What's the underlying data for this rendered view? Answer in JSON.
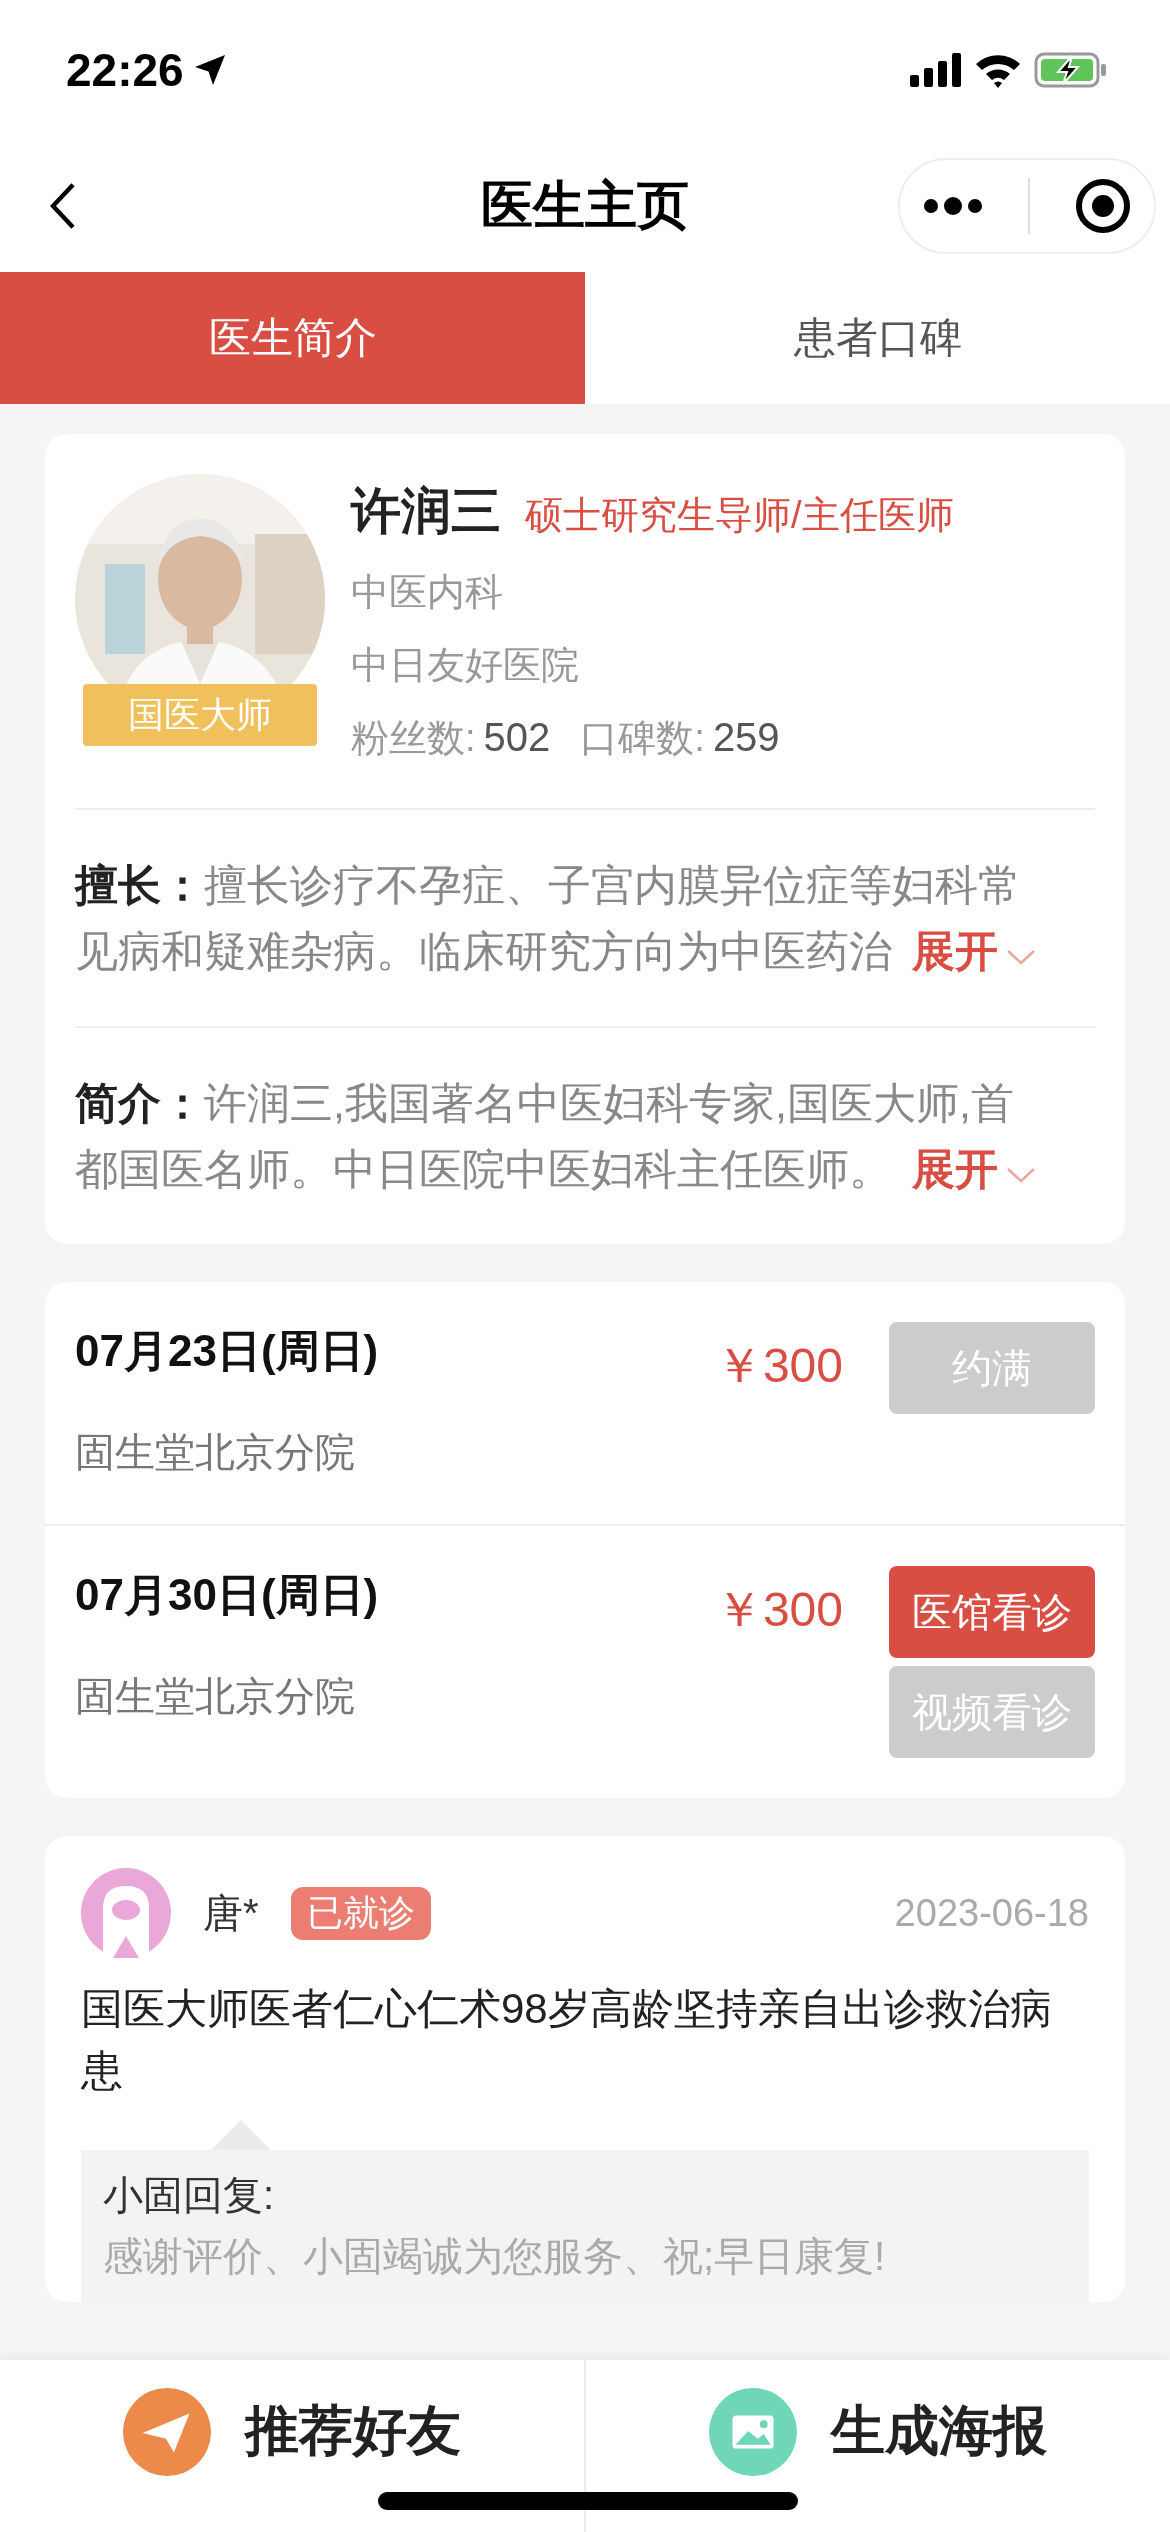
{
  "status_bar": {
    "time": "22:26"
  },
  "nav": {
    "title": "医生主页"
  },
  "tabs": [
    {
      "label": "医生简介",
      "selected": true
    },
    {
      "label": "患者口碑",
      "selected": false
    }
  ],
  "doctor": {
    "badge": "国医大师",
    "name": "许润三",
    "title": "硕士研究生导师/主任医师",
    "department": "中医内科",
    "hospital": "中日友好医院",
    "stats": [
      {
        "label": "粉丝数:",
        "value": "502"
      },
      {
        "label": "口碑数:",
        "value": "259"
      }
    ],
    "sections": [
      {
        "label": "擅长：",
        "text": "擅长诊疗不孕症、子宫内膜异位症等妇科常见病和疑难杂病。临床研究方向为中医药治",
        "expand": "展开"
      },
      {
        "label": "简介：",
        "text": "许润三,我国著名中医妇科专家,国医大师,首都国医名师。中日医院中医妇科主任医师。",
        "expand": "展开"
      }
    ]
  },
  "schedule": [
    {
      "date": "07月23日(周日)",
      "location": "固生堂北京分院",
      "price": "￥300",
      "buttons": [
        {
          "label": "约满",
          "disabled": true
        }
      ]
    },
    {
      "date": "07月30日(周日)",
      "location": "固生堂北京分院",
      "price": "￥300",
      "buttons": [
        {
          "label": "医馆看诊",
          "disabled": false
        },
        {
          "label": "视频看诊",
          "disabled": true
        }
      ]
    }
  ],
  "reviews": [
    {
      "name": "唐*",
      "tag": "已就诊",
      "date": "2023-06-18",
      "text": "国医大师医者仁心仁术98岁高龄坚持亲自出诊救治病患",
      "reply": {
        "label": "小固回复:",
        "text": "感谢评价、小固竭诚为您服务、祝;早日康复!"
      }
    }
  ],
  "bottom_bar": [
    {
      "label": "推荐好友",
      "kind": "share"
    },
    {
      "label": "生成海报",
      "kind": "poster"
    }
  ]
}
